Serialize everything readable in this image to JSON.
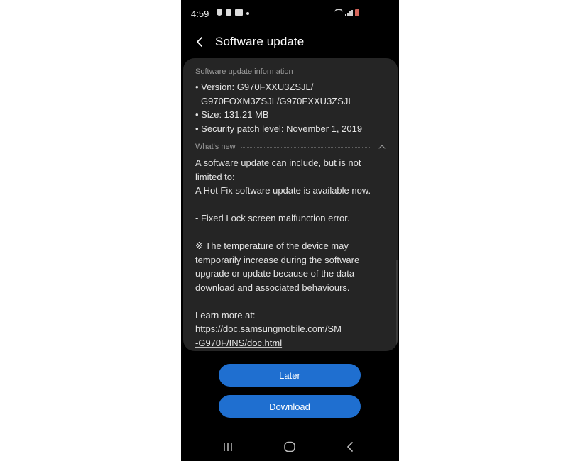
{
  "status_bar": {
    "time": "4:59"
  },
  "header": {
    "title": "Software update"
  },
  "info_section": {
    "heading": "Software update information",
    "lines": [
      "• Version: G970FXXU3ZSJL/",
      "G970FOXM3ZSJL/G970FXXU3ZSJL",
      "• Size: 131.21 MB",
      "• Security patch level: November 1, 2019"
    ]
  },
  "whats_new": {
    "heading": "What's new",
    "lines": [
      "A software update can include, but is not",
      "limited to:",
      "A Hot Fix software update is available now.",
      "",
      " - Fixed Lock screen malfunction error.",
      "",
      "※ The temperature of the device may",
      "temporarily increase during the software",
      "upgrade or update because of the data",
      "download and associated behaviours.",
      "",
      "Learn more at:"
    ],
    "link_lines": [
      "https://doc.samsungmobile.com/SM",
      "-G970F/INS/doc.html"
    ]
  },
  "buttons": {
    "later": "Later",
    "download": "Download"
  },
  "colors": {
    "background": "#000000",
    "card": "#252525",
    "button": "#1f6fd0",
    "battery": "#d4655a"
  },
  "icons": {
    "back": "chevron-left-icon",
    "collapse": "chevron-up-icon",
    "nav_recents": "recents-icon",
    "nav_home": "home-icon",
    "nav_back": "back-nav-icon"
  }
}
